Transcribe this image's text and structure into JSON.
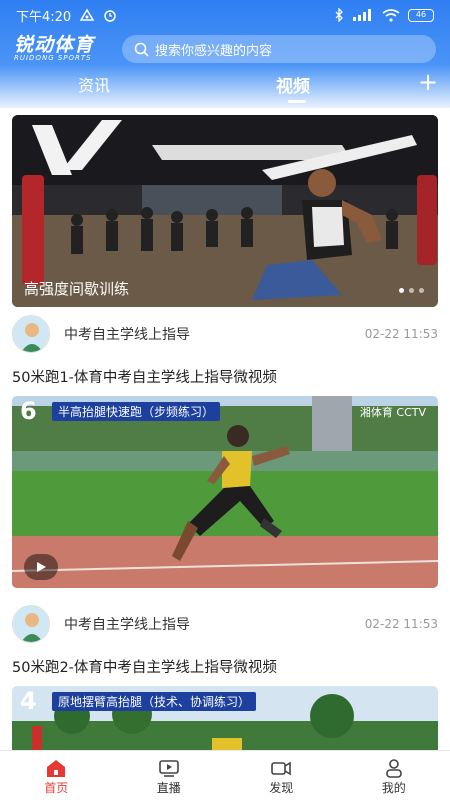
{
  "status_bar": {
    "time": "下午4:20",
    "battery": "46"
  },
  "brand": {
    "name": "锐动体育",
    "subtitle": "RUIDONG SPORTS"
  },
  "search": {
    "placeholder": "搜索你感兴趣的内容"
  },
  "tabs": [
    {
      "label": "资讯",
      "active": false
    },
    {
      "label": "视频",
      "active": true
    }
  ],
  "banner": {
    "caption": "高强度间歇训练",
    "slides": 3,
    "active_slide": 1
  },
  "posts": [
    {
      "author": "中考自主学线上指导",
      "time": "02-22 11:53",
      "title": "50米跑1-体育中考自主学线上指导微视频",
      "overlay_num": "6",
      "overlay_text": "半高抬腿快速跑（步频练习）",
      "overlay_logo": "湘体育 CCTV"
    },
    {
      "author": "中考自主学线上指导",
      "time": "02-22 11:53",
      "title": "50米跑2-体育中考自主学线上指导微视频",
      "overlay_num": "4",
      "overlay_text": "原地摆臂高抬腿（技术、协调练习）"
    }
  ],
  "bottom_nav": [
    {
      "label": "首页",
      "icon": "home-icon",
      "active": true
    },
    {
      "label": "直播",
      "icon": "tv-icon",
      "active": false
    },
    {
      "label": "发现",
      "icon": "camera-icon",
      "active": false
    },
    {
      "label": "我的",
      "icon": "profile-icon",
      "active": false
    }
  ],
  "colors": {
    "brand_blue": "#2f7ff3",
    "active_red": "#e53935"
  }
}
